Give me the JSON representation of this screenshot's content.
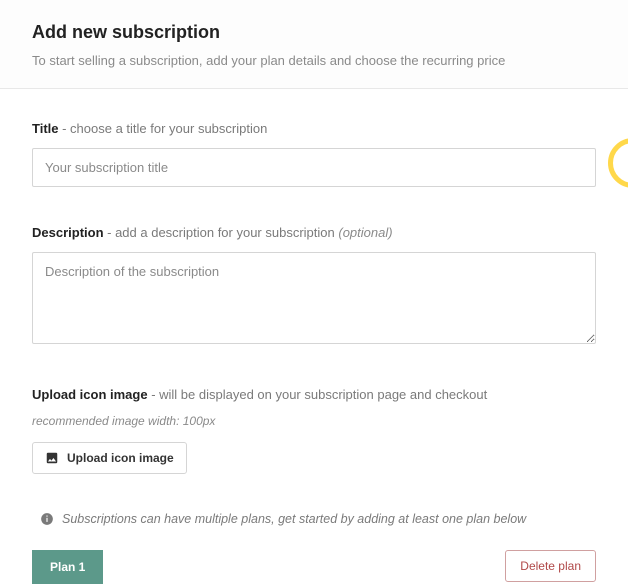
{
  "header": {
    "title": "Add new subscription",
    "subtitle": "To start selling a subscription, add your plan details and choose the recurring price"
  },
  "fields": {
    "title": {
      "label_strong": "Title",
      "label_hint": " - choose a title for your subscription",
      "placeholder": "Your subscription title"
    },
    "description": {
      "label_strong": "Description",
      "label_hint": " - add a description for your subscription ",
      "label_optional": "(optional)",
      "placeholder": "Description of the subscription"
    },
    "upload": {
      "label_strong": "Upload icon image",
      "label_hint": " - will be displayed on your subscription page and checkout",
      "recommended": "recommended image width: 100px",
      "button": "Upload icon image"
    }
  },
  "info": {
    "text": "Subscriptions can have multiple plans, get started by adding at least one plan below"
  },
  "plans": {
    "tab1": "Plan 1",
    "delete": "Delete plan"
  }
}
